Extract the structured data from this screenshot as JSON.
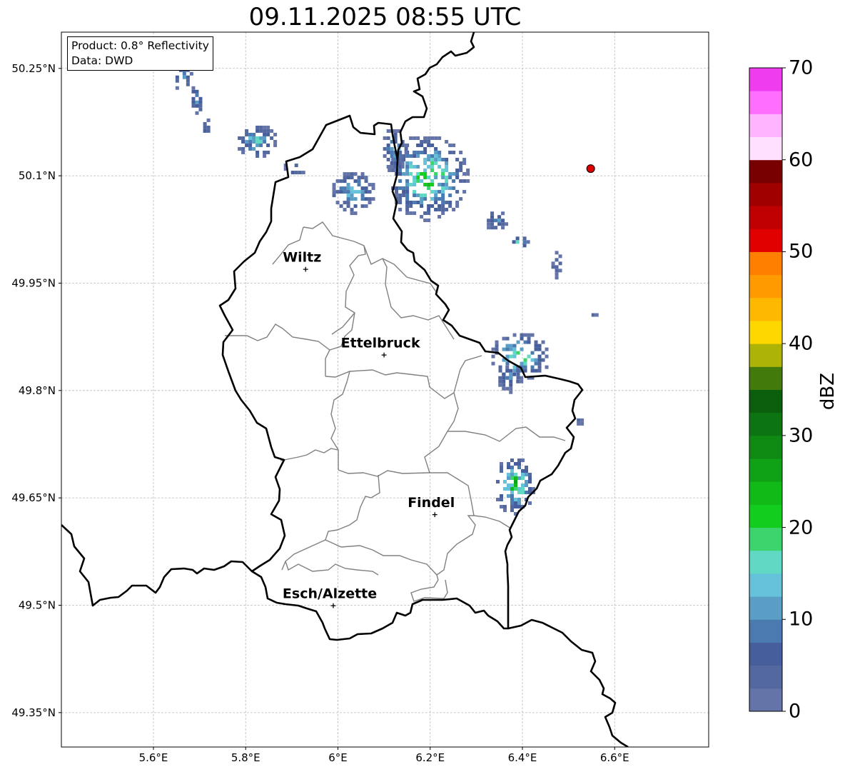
{
  "title": "09.11.2025 08:55 UTC",
  "info": {
    "product": "Product: 0.8° Reflectivity",
    "source": "Data: DWD"
  },
  "map": {
    "lon_range": [
      5.4,
      6.8
    ],
    "lat_range": [
      49.3,
      50.3
    ],
    "x_ticks": [
      {
        "v": 5.6,
        "label": "5.6°E"
      },
      {
        "v": 5.8,
        "label": "5.8°E"
      },
      {
        "v": 6.0,
        "label": "6°E"
      },
      {
        "v": 6.2,
        "label": "6.2°E"
      },
      {
        "v": 6.4,
        "label": "6.4°E"
      },
      {
        "v": 6.6,
        "label": "6.6°E"
      }
    ],
    "y_ticks": [
      {
        "v": 49.35,
        "label": "49.35°N"
      },
      {
        "v": 49.5,
        "label": "49.5°N"
      },
      {
        "v": 49.65,
        "label": "49.65°N"
      },
      {
        "v": 49.8,
        "label": "49.8°N"
      },
      {
        "v": 49.95,
        "label": "49.95°N"
      },
      {
        "v": 50.1,
        "label": "50.1°N"
      },
      {
        "v": 50.25,
        "label": "50.25°N"
      }
    ],
    "places": [
      {
        "name": "Wiltz",
        "lon": 5.93,
        "lat": 49.969
      },
      {
        "name": "Ettelbruck",
        "lon": 6.1,
        "lat": 49.849
      },
      {
        "name": "Findel",
        "lon": 6.21,
        "lat": 49.626
      },
      {
        "name": "Esch/Alzette",
        "lon": 5.99,
        "lat": 49.499
      }
    ],
    "radar_site": {
      "lon": 6.548,
      "lat": 50.11,
      "color": "#e00000"
    }
  },
  "colorbar": {
    "label": "dBZ",
    "min": 0,
    "max": 70,
    "ticks": [
      {
        "v": 0,
        "label": "0"
      },
      {
        "v": 10,
        "label": "10"
      },
      {
        "v": 20,
        "label": "20"
      },
      {
        "v": 30,
        "label": "30"
      },
      {
        "v": 40,
        "label": "40"
      },
      {
        "v": 50,
        "label": "50"
      },
      {
        "v": 60,
        "label": "60"
      },
      {
        "v": 70,
        "label": "70"
      }
    ],
    "colors": [
      "#6474a8",
      "#5468a0",
      "#465e9c",
      "#4a7ab0",
      "#5a9ec6",
      "#66c2da",
      "#60d8c4",
      "#3cd46c",
      "#12cc1e",
      "#12ba18",
      "#10a216",
      "#0e8a12",
      "#0c7410",
      "#0a5e0c",
      "#437a0c",
      "#adb406",
      "#ffd700",
      "#ffb800",
      "#ff9b00",
      "#ff8000",
      "#e00000",
      "#c00000",
      "#a00000",
      "#780000",
      "#ffe0ff",
      "#ffb4ff",
      "#ff6eff",
      "#ee3cee"
    ]
  },
  "echoes": [
    {
      "lon": 5.66,
      "lat": 50.24,
      "rx": 0.02,
      "ry": 0.02,
      "core": 12
    },
    {
      "lon": 5.69,
      "lat": 50.21,
      "rx": 0.015,
      "ry": 0.025,
      "core": 14
    },
    {
      "lon": 5.71,
      "lat": 50.17,
      "rx": 0.01,
      "ry": 0.015,
      "core": 8
    },
    {
      "lon": 5.82,
      "lat": 50.15,
      "rx": 0.045,
      "ry": 0.025,
      "core": 18
    },
    {
      "lon": 5.9,
      "lat": 50.11,
      "rx": 0.025,
      "ry": 0.012,
      "core": 8
    },
    {
      "lon": 6.03,
      "lat": 50.08,
      "rx": 0.05,
      "ry": 0.03,
      "core": 16
    },
    {
      "lon": 6.19,
      "lat": 50.1,
      "rx": 0.09,
      "ry": 0.06,
      "core": 25
    },
    {
      "lon": 6.12,
      "lat": 50.14,
      "rx": 0.03,
      "ry": 0.03,
      "core": 16
    },
    {
      "lon": 6.34,
      "lat": 50.04,
      "rx": 0.025,
      "ry": 0.015,
      "core": 12
    },
    {
      "lon": 6.39,
      "lat": 50.01,
      "rx": 0.02,
      "ry": 0.01,
      "core": 18
    },
    {
      "lon": 6.47,
      "lat": 49.98,
      "rx": 0.015,
      "ry": 0.02,
      "core": 6
    },
    {
      "lon": 6.39,
      "lat": 49.85,
      "rx": 0.065,
      "ry": 0.035,
      "core": 22
    },
    {
      "lon": 6.37,
      "lat": 49.82,
      "rx": 0.03,
      "ry": 0.02,
      "core": 12
    },
    {
      "lon": 6.38,
      "lat": 49.67,
      "rx": 0.045,
      "ry": 0.04,
      "core": 26
    },
    {
      "lon": 6.52,
      "lat": 49.76,
      "rx": 0.01,
      "ry": 0.006,
      "core": 6
    },
    {
      "lon": 6.55,
      "lat": 49.91,
      "rx": 0.008,
      "ry": 0.008,
      "core": 6
    }
  ]
}
